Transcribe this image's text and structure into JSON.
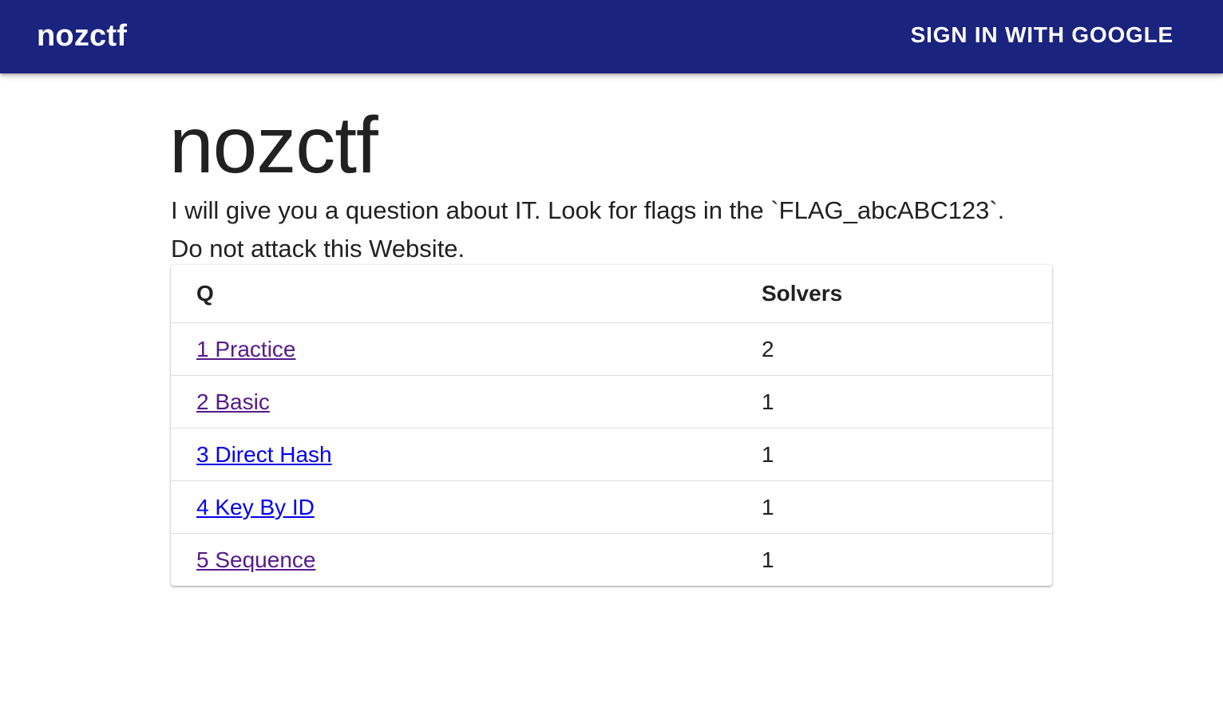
{
  "appbar": {
    "brand": "nozctf",
    "signin_label": "SIGN IN WITH GOOGLE",
    "background_color": "#1a237e"
  },
  "main": {
    "title": "nozctf",
    "intro_line1": "I will give you a question about IT. Look for flags in the `FLAG_abcABC123`.",
    "intro_line2": "Do not attack this Website."
  },
  "table": {
    "headers": [
      "Q",
      "Solvers"
    ],
    "rows": [
      {
        "question": "1 Practice",
        "solvers": "2",
        "visited": true
      },
      {
        "question": "2 Basic",
        "solvers": "1",
        "visited": true
      },
      {
        "question": "3 Direct Hash",
        "solvers": "1",
        "visited": false
      },
      {
        "question": "4 Key By ID",
        "solvers": "1",
        "visited": false
      },
      {
        "question": "5 Sequence",
        "solvers": "1",
        "visited": true
      }
    ]
  },
  "colors": {
    "visited_link": "#551a8b",
    "unvisited_link": "#0000ee"
  }
}
